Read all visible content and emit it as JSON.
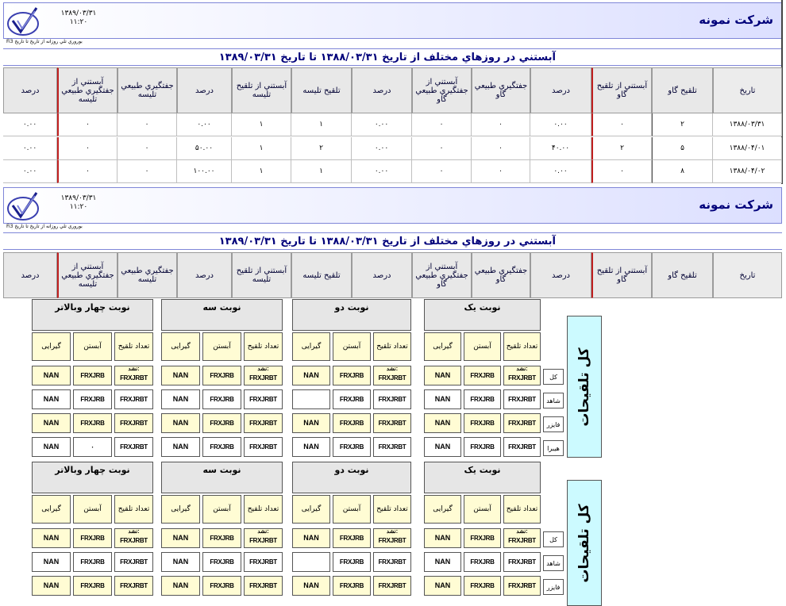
{
  "company": "شرکت نمونه",
  "report_date": "۱۳۸۹/۰۳/۳۱",
  "report_time": "۱۱:۲۰",
  "subtitle_line": "بوروري تلي روزانه از تاريخ تا تاريخ Fi3",
  "report_title": "آبستني در روزهاي مختلف    از تاريخ ۱۳۸۸/۰۳/۳۱ تا تاريخ ۱۳۸۹/۰۳/۳۱",
  "columns": [
    "تاریخ",
    "تلقیح گاو",
    "آبستني از تلقیح گاو",
    "درصد",
    "جفتگیري طبیعي گاو",
    "آبستني از جفتگیري طبیعي گاو",
    "درصد",
    "تلقیح تلیسه",
    "آبستني از تلقیح تلیسه",
    "درصد",
    "جفتگیري طبیعي تلیسه",
    "آبستني از جفتگیري طبیعي تلیسه",
    "درصد"
  ],
  "rows": [
    [
      "۱۳۸۸/۰۳/۳۱",
      "۲",
      "۰",
      "۰.۰۰",
      "۰",
      "۰",
      "۰.۰۰",
      "۱",
      "۱",
      "۰.۰۰",
      "۰",
      "۰",
      "۰.۰۰"
    ],
    [
      "۱۳۸۸/۰۴/۰۱",
      "۵",
      "۲",
      "۴۰.۰۰",
      "۰",
      "۰",
      "۰.۰۰",
      "۲",
      "۱",
      "۵۰.۰۰",
      "۰",
      "۰",
      "۰.۰۰"
    ],
    [
      "۱۳۸۸/۰۴/۰۲",
      "۸",
      "۰",
      "۰.۰۰",
      "۰",
      "۰",
      "۰.۰۰",
      "۱",
      "۱",
      "۱۰۰.۰۰",
      "۰",
      "۰",
      "۰.۰۰"
    ]
  ],
  "panel": {
    "big_title": "کل تلقیحات",
    "shifts": [
      "نوبت يک",
      "نوبت دو",
      "نوبت سه",
      "نوبت چهار وبالاتر"
    ],
    "subheaders": [
      "تعداد تلقیح",
      "آبستن",
      "گیرایی"
    ],
    "people": [
      "کل",
      "شاهد",
      "فایزر",
      "هیبرا"
    ],
    "cell_frx": "FRXJRB",
    "cell_frxt": "FRXJRBT",
    "cell_nan": "NAN",
    "cell_zero": "۰",
    "cell_nashod": "نشد:"
  }
}
